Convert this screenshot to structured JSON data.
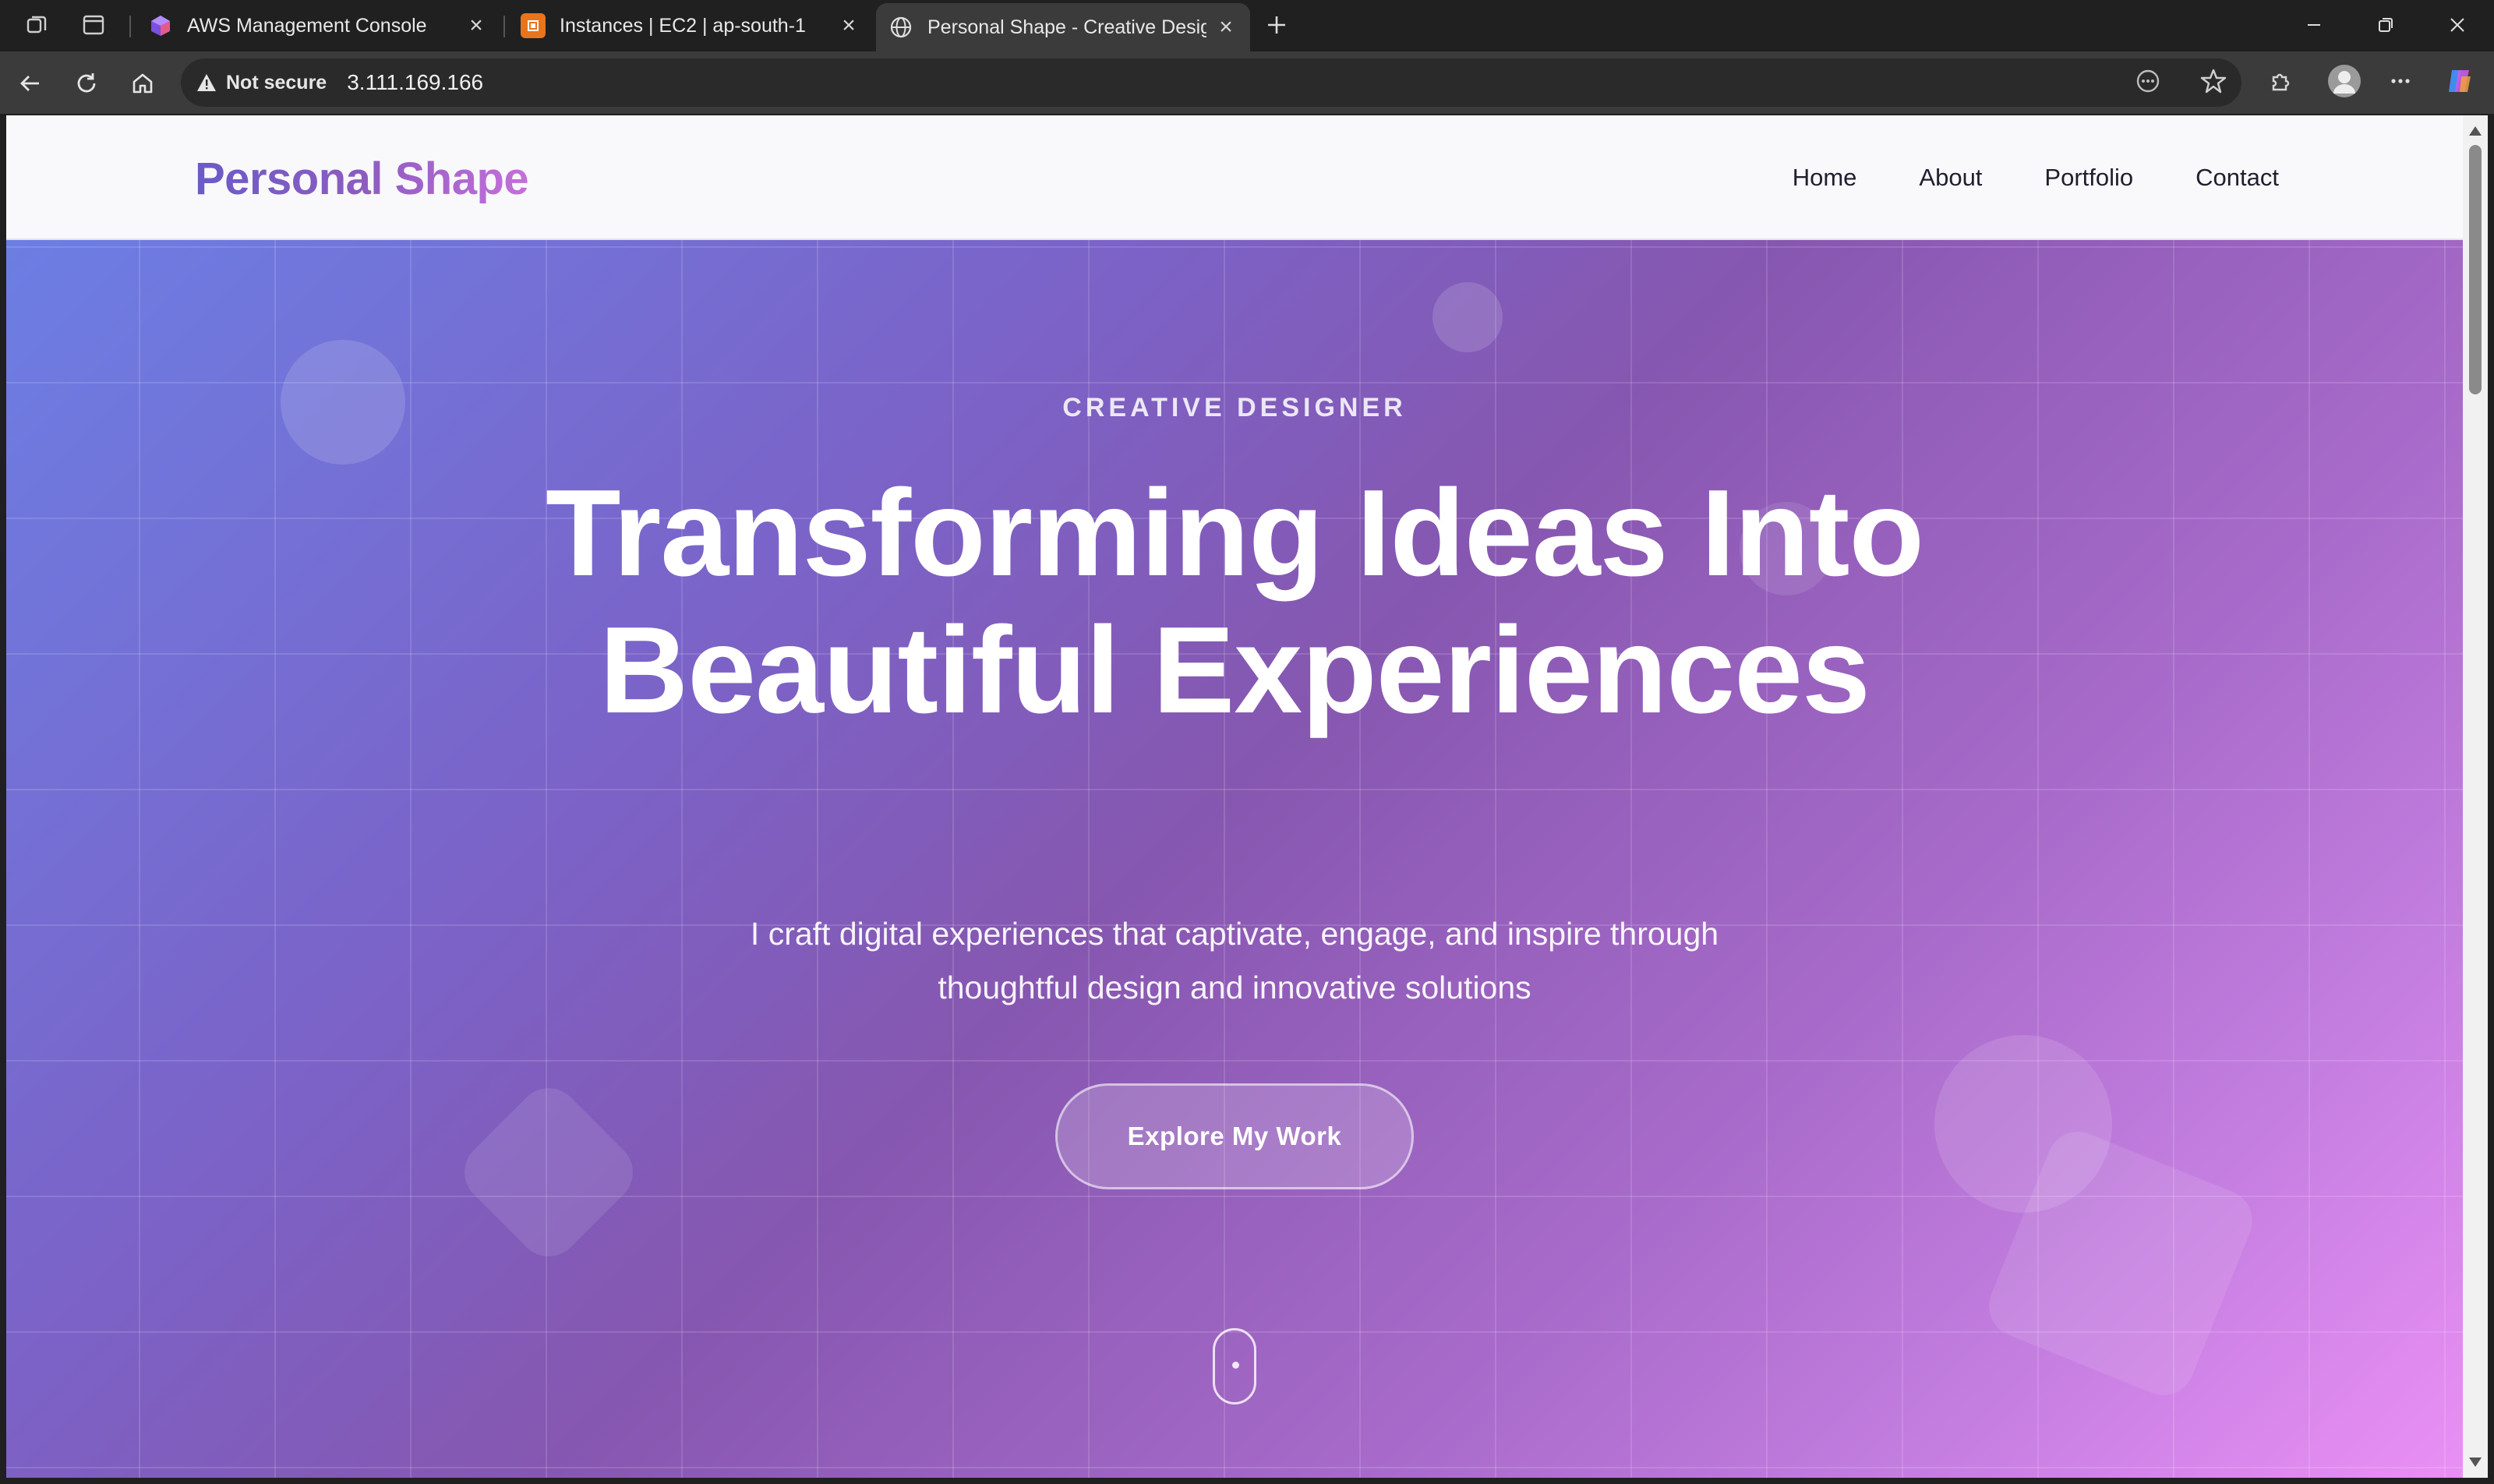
{
  "browser": {
    "tabs": [
      {
        "title": "AWS Management Console",
        "favicon": "aws-cube-icon",
        "active": false
      },
      {
        "title": "Instances | EC2 | ap-south-1",
        "favicon": "ec2-icon",
        "active": false
      },
      {
        "title": "Personal Shape - Creative Design",
        "favicon": "globe-icon",
        "active": true
      }
    ],
    "security_label": "Not secure",
    "url": "3.111.169.166"
  },
  "site": {
    "brand": "Personal Shape",
    "nav": [
      "Home",
      "About",
      "Portfolio",
      "Contact"
    ]
  },
  "hero": {
    "eyebrow": "CREATIVE DESIGNER",
    "headline": "Transforming Ideas Into Beautiful Experiences",
    "subtext": "I craft digital experiences that captivate, engage, and inspire through thoughtful design and innovative solutions",
    "cta_label": "Explore My Work"
  },
  "colors": {
    "gradient_start": "#6c7ee3",
    "gradient_mid": "#8657b0",
    "gradient_end": "#ea8ff5",
    "brand_start": "#6a5bc8",
    "brand_end": "#c56fdb"
  }
}
